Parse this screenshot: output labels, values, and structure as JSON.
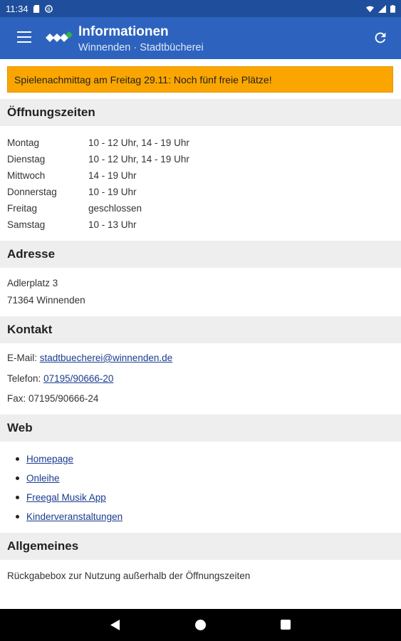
{
  "status_bar": {
    "time": "11:34",
    "icons": [
      "sd-card-icon",
      "data-saver-icon",
      "wifi-icon",
      "signal-icon",
      "battery-icon"
    ]
  },
  "app_bar": {
    "title": "Informationen",
    "subtitle": "Winnenden · Stadtbücherei",
    "icons": [
      "menu-icon",
      "app-logo-icon",
      "refresh-icon"
    ]
  },
  "notice": {
    "text": "Spielenachmittag am Freitag 29.11: Noch fünf freie Plätze!",
    "color": "#fba600"
  },
  "hours": {
    "title": "Öffnungszeiten",
    "rows": [
      {
        "day": "Montag",
        "time": "10 - 12 Uhr, 14 - 19 Uhr"
      },
      {
        "day": "Dienstag",
        "time": "10 - 12 Uhr, 14 - 19 Uhr"
      },
      {
        "day": "Mittwoch",
        "time": "14 - 19 Uhr"
      },
      {
        "day": "Donnerstag",
        "time": "10 - 19 Uhr"
      },
      {
        "day": "Freitag",
        "time": "geschlossen"
      },
      {
        "day": "Samstag",
        "time": "10 - 13 Uhr"
      }
    ]
  },
  "address": {
    "title": "Adresse",
    "line1": "Adlerplatz 3",
    "line2": "71364 Winnenden"
  },
  "contact": {
    "title": "Kontakt",
    "email_label": "E-Mail:",
    "email": "stadtbuecherei@winnenden.de",
    "phone_label": "Telefon:",
    "phone": "07195/90666-20",
    "fax": "Fax: 07195/90666-24"
  },
  "web": {
    "title": "Web",
    "links": [
      "Homepage",
      "Onleihe",
      "Freegal Musik App",
      "Kinderveranstaltungen"
    ]
  },
  "general": {
    "title": "Allgemeines",
    "text": "Rückgabebox zur Nutzung außerhalb der Öffnungszeiten"
  },
  "colors": {
    "app_bar": "#2d63be",
    "status_bar": "#1f4e9c",
    "section_bg": "#eeeeee",
    "link": "#1a3b8f"
  },
  "nav_bar": {
    "icons": [
      "back-icon",
      "home-icon",
      "recents-icon"
    ]
  }
}
